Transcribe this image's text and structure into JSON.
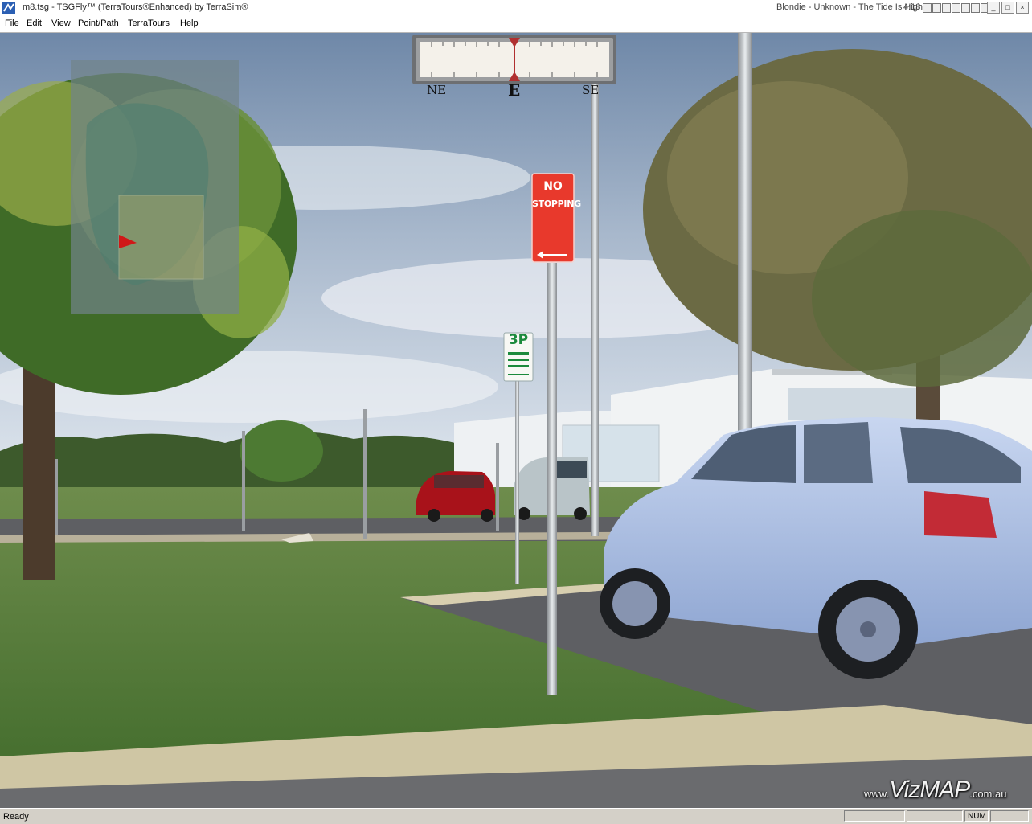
{
  "window": {
    "title": "m8.tsg - TSGFly™ (TerraTours®Enhanced) by TerraSim®",
    "now_playing": "Blondie - Unknown - The Tide Is High",
    "clock": "4:18",
    "controls": {
      "minimize": "_",
      "maximize": "□",
      "close": "×"
    }
  },
  "menu": {
    "items": [
      "File",
      "Edit",
      "View",
      "Point/Path",
      "TerraTours",
      "Help"
    ]
  },
  "scene": {
    "compass": {
      "left": "NE",
      "center": "E",
      "right": "SE"
    },
    "signs": {
      "no_stopping_line1": "NO",
      "no_stopping_line2": "STOPPING",
      "parking": "3P"
    },
    "watermark": {
      "prefix": "www.",
      "main": "VizMAP",
      "suffix": ".com.au"
    }
  },
  "status": {
    "text": "Ready",
    "num_indicator": "NUM"
  },
  "colors": {
    "sky_top": "#6f88a8",
    "sky_horizon": "#dfe6ee",
    "grass": "#4f7a34",
    "road": "#5e5f63",
    "sign_red": "#e8392c",
    "sign_green": "#1b8a3c",
    "car_blue": "#a9c0e6",
    "car_red": "#a8121a"
  }
}
